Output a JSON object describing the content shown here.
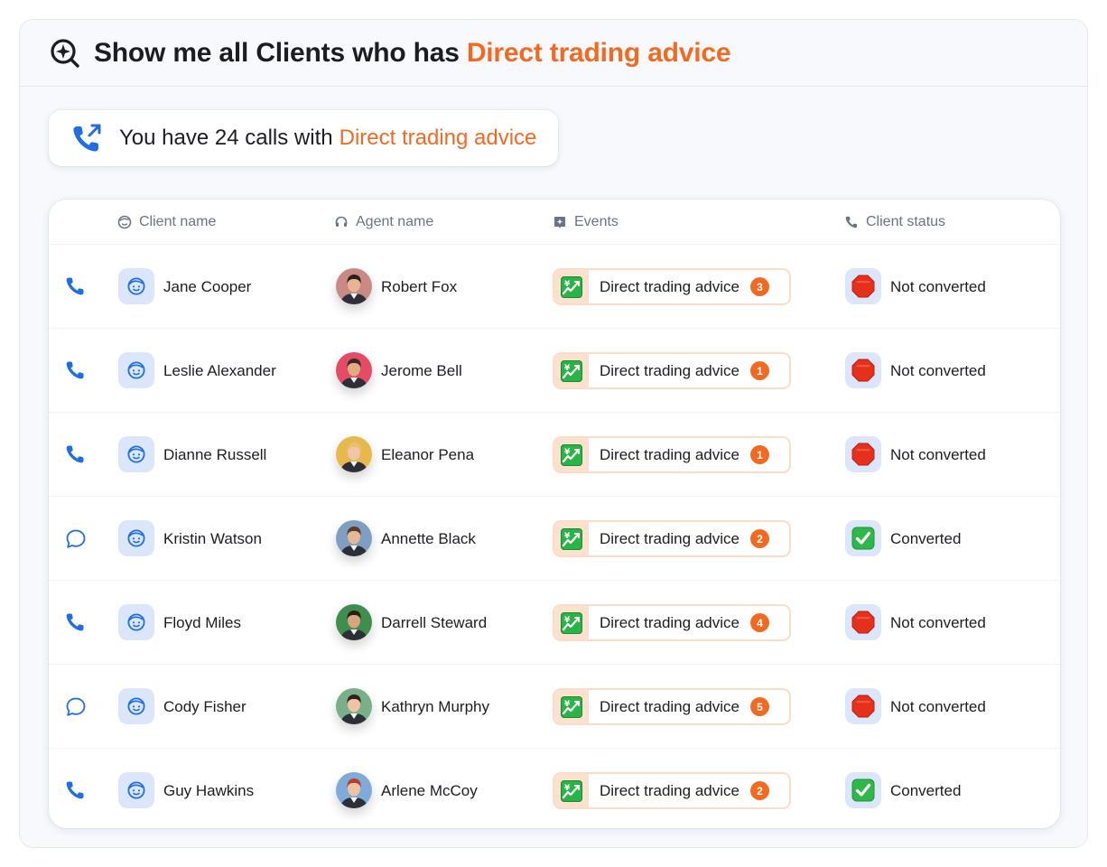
{
  "header": {
    "title_prefix": "Show me all Clients who has",
    "title_accent": "Direct trading advice",
    "icon": "search-sparkle-icon"
  },
  "calls_summary": {
    "text": "You have 24 calls with",
    "accent": "Direct trading advice",
    "icon": "phone-outgoing-icon"
  },
  "table": {
    "columns": [
      {
        "label": "Client name",
        "icon": "smile-face-icon"
      },
      {
        "label": "Agent name",
        "icon": "headset-icon"
      },
      {
        "label": "Events",
        "icon": "sparkle-square-icon"
      },
      {
        "label": "Client status",
        "icon": "phone-icon"
      }
    ],
    "rows": [
      {
        "channel": "phone",
        "client": "Jane Cooper",
        "agent": "Robert Fox",
        "event": "Direct trading advice",
        "count": "3",
        "status": "Not converted",
        "converted": false
      },
      {
        "channel": "phone",
        "client": "Leslie Alexander",
        "agent": "Jerome Bell",
        "event": "Direct trading advice",
        "count": "1",
        "status": "Not converted",
        "converted": false
      },
      {
        "channel": "phone",
        "client": "Dianne Russell",
        "agent": "Eleanor Pena",
        "event": "Direct trading advice",
        "count": "1",
        "status": "Not converted",
        "converted": false
      },
      {
        "channel": "chat",
        "client": "Kristin Watson",
        "agent": "Annette Black",
        "event": "Direct trading advice",
        "count": "2",
        "status": "Converted",
        "converted": true
      },
      {
        "channel": "phone",
        "client": "Floyd Miles",
        "agent": "Darrell Steward",
        "event": "Direct trading advice",
        "count": "4",
        "status": "Not converted",
        "converted": false
      },
      {
        "channel": "chat",
        "client": "Cody Fisher",
        "agent": "Kathryn Murphy",
        "event": "Direct trading advice",
        "count": "5",
        "status": "Not converted",
        "converted": false
      },
      {
        "channel": "phone",
        "client": "Guy Hawkins",
        "agent": "Arlene McCoy",
        "event": "Direct trading advice",
        "count": "2",
        "status": "Converted",
        "converted": true
      }
    ]
  },
  "colors": {
    "accent": "#f26a21",
    "primary_blue": "#1f6fe0",
    "avatar_bg": "#dbe6fb",
    "chip_border": "#fbdcc8",
    "chip_bg": "#fde1cf",
    "stop_red": "#e5301c",
    "check_green": "#2fb84a"
  },
  "agent_avatars": [
    {
      "bg": "#c98a86",
      "skin": "#e9b48f",
      "hair": "#2a1f1a"
    },
    {
      "bg": "#e44b64",
      "skin": "#e1ab86",
      "hair": "#3a2c22"
    },
    {
      "bg": "#e6b94e",
      "skin": "#f0c7a5",
      "hair": "#e8c170"
    },
    {
      "bg": "#7f9fc2",
      "skin": "#e6b894",
      "hair": "#5a3b28"
    },
    {
      "bg": "#3e8f4e",
      "skin": "#d9a57f",
      "hair": "#2b1e16"
    },
    {
      "bg": "#79b089",
      "skin": "#efc3a3",
      "hair": "#2c211b"
    },
    {
      "bg": "#7faad9",
      "skin": "#f1c3a1",
      "hair": "#b4422a"
    }
  ]
}
